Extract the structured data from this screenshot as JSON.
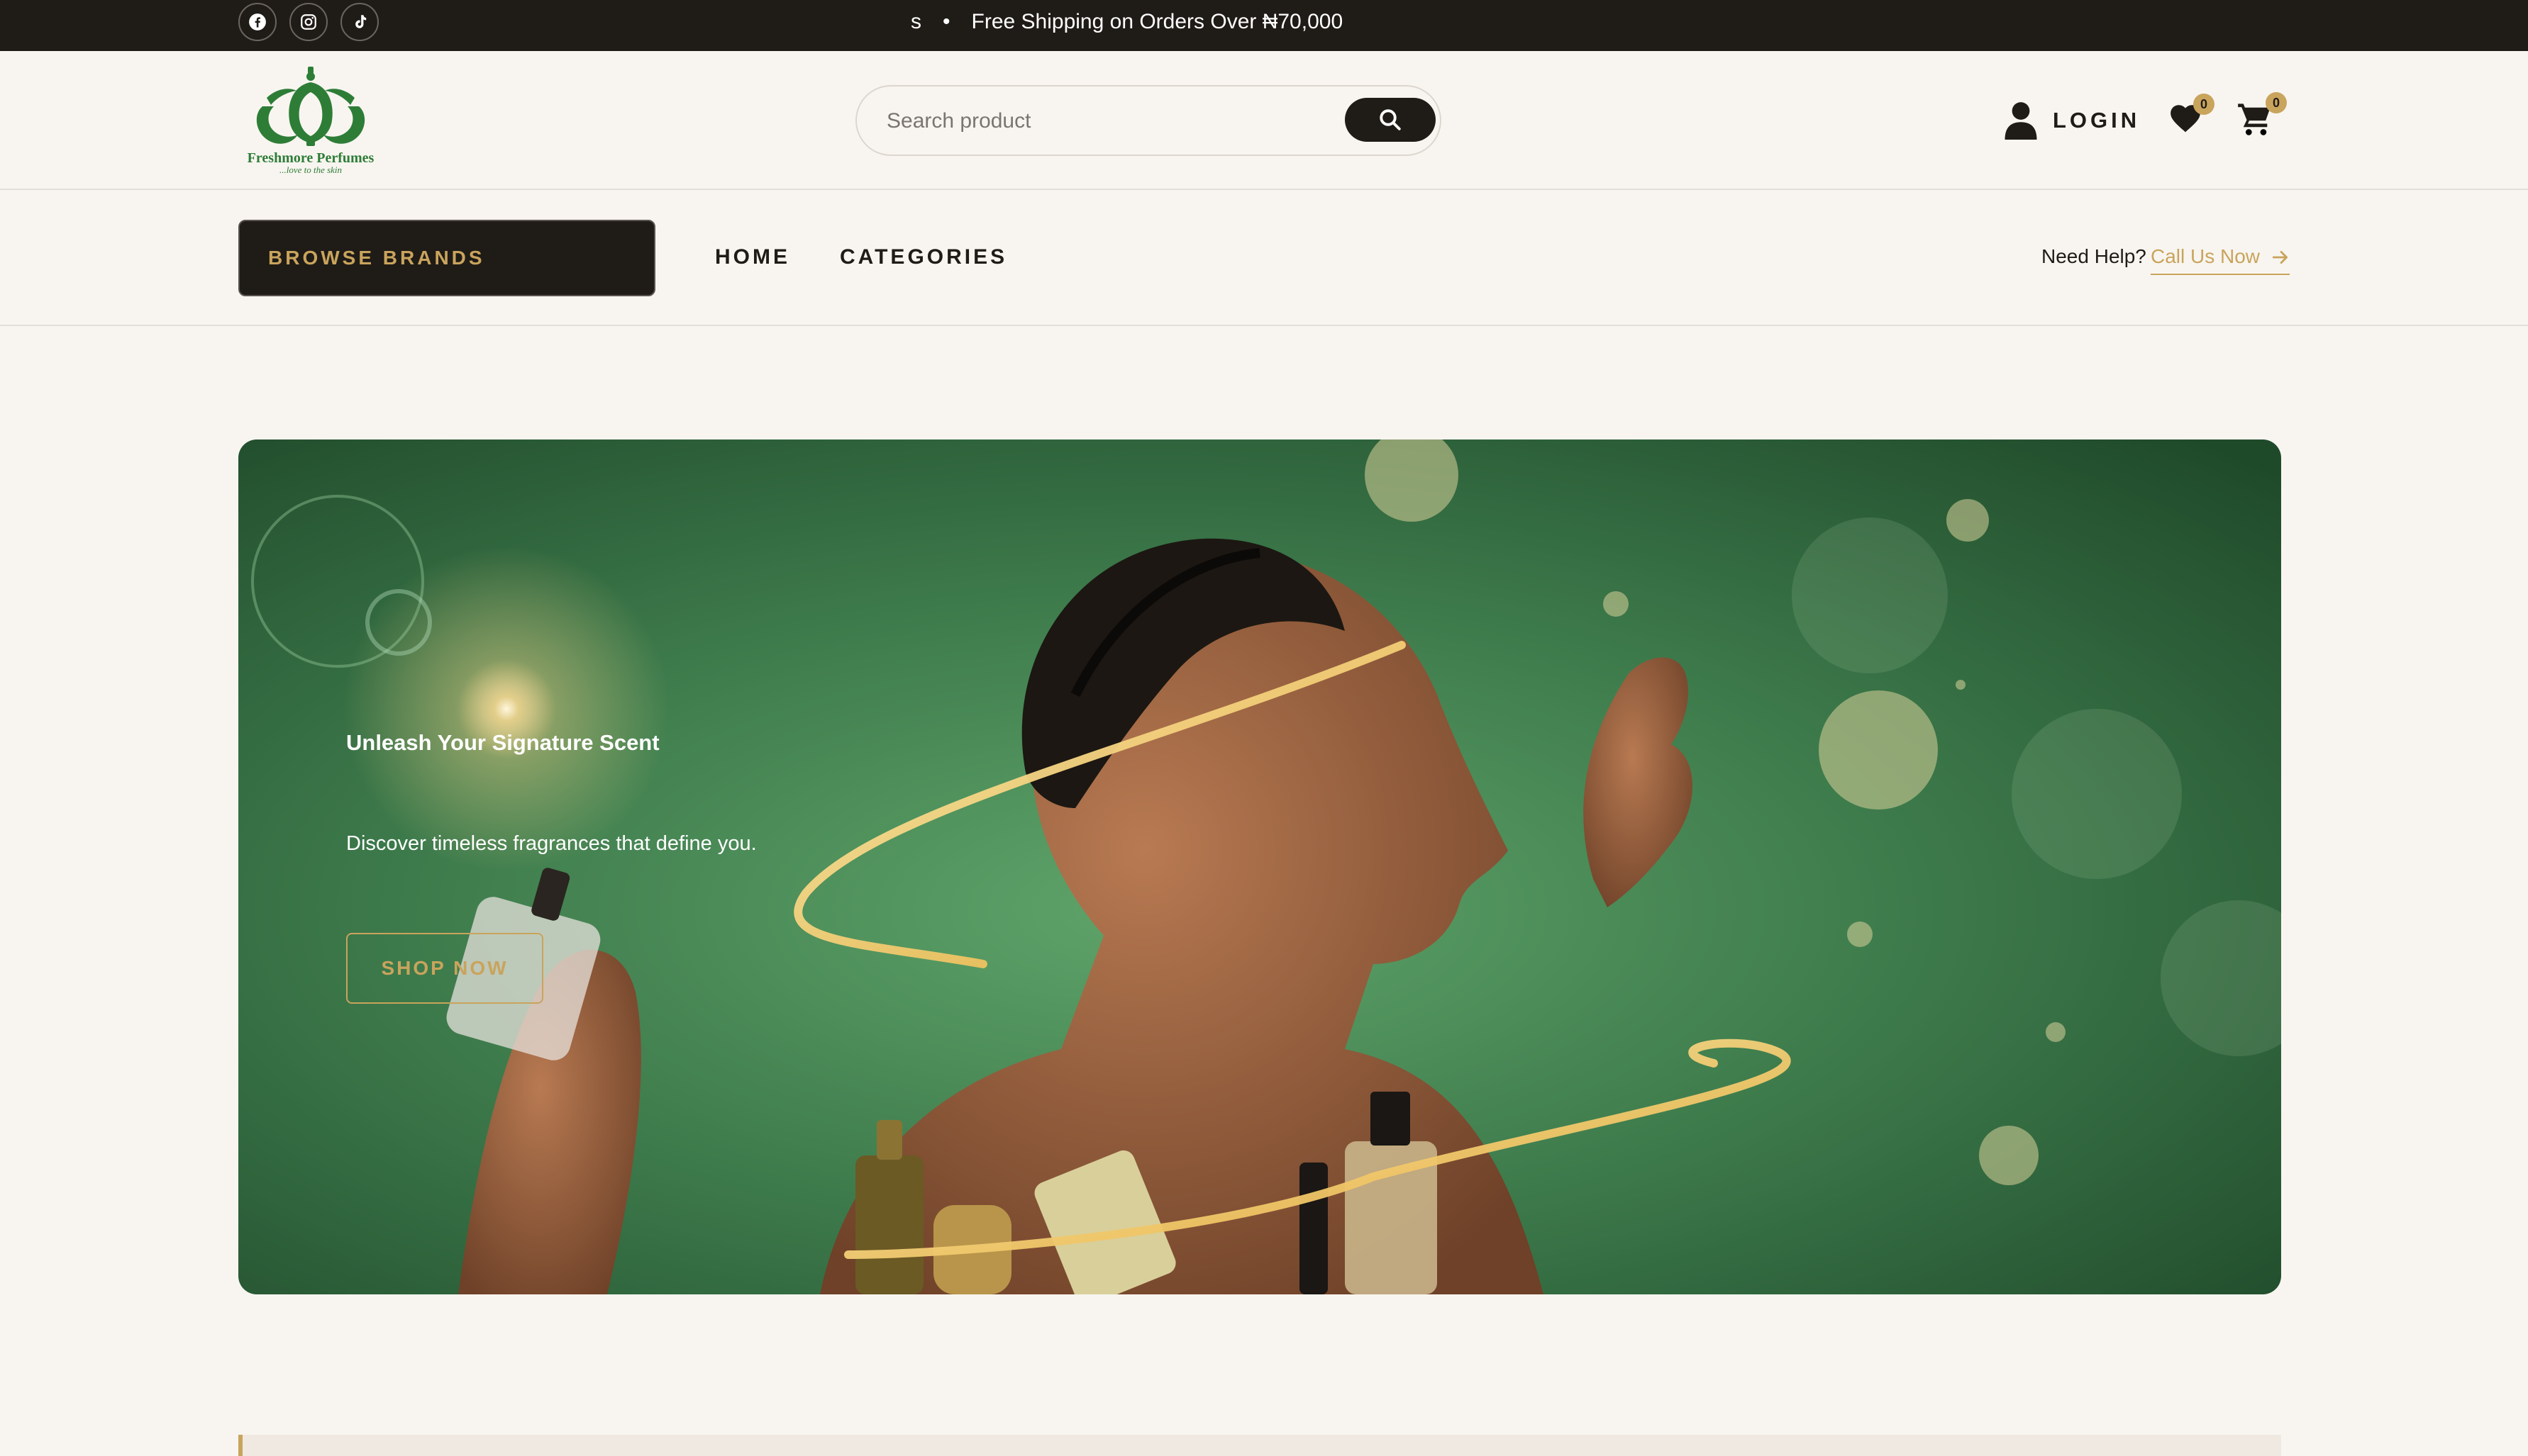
{
  "topbar": {
    "ticker_fragment": "s",
    "ticker_separator": "•",
    "announcement": "Free Shipping on Orders Over ₦70,000",
    "social_icons": [
      "facebook-icon",
      "instagram-icon",
      "tiktok-icon"
    ]
  },
  "brand": {
    "name": "Freshmore Perfumes",
    "tagline": "...love to the skin",
    "color": "#2e7d37"
  },
  "search": {
    "placeholder": "Search product",
    "value": ""
  },
  "account": {
    "login_label": "LOGIN",
    "wishlist_count": "0",
    "cart_count": "0"
  },
  "nav": {
    "browse_label": "BROWSE BRANDS",
    "links": [
      "HOME",
      "CATEGORIES"
    ],
    "help_label": "Need Help?",
    "call_label": "Call Us Now"
  },
  "hero": {
    "title": "Unleash Your Signature Scent",
    "subtitle": "Discover timeless fragrances that define you.",
    "cta_label": "SHOP NOW"
  },
  "colors": {
    "dark": "#1f1b17",
    "gold": "#c9a45c",
    "background": "#f8f5f0",
    "hero_green": "#3d7a4b"
  }
}
